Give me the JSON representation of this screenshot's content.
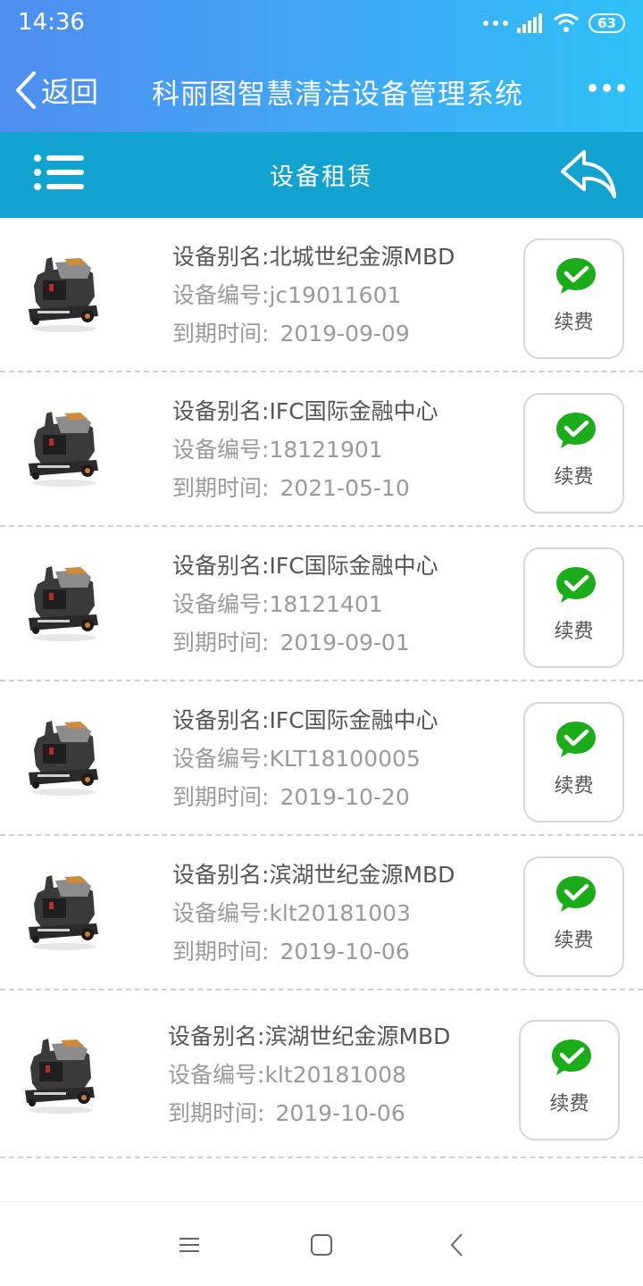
{
  "status_bar": {
    "time": "14:36",
    "battery": "63",
    "icons": [
      "more-dots-icon",
      "signal-icon",
      "wifi-icon",
      "battery-icon"
    ]
  },
  "header": {
    "back_label": "返回",
    "title": "科丽图智慧清洁设备管理系统"
  },
  "subheader": {
    "title": "设备租赁"
  },
  "labels": {
    "alias": "设备别名:",
    "number": "设备编号:",
    "expiry": "到期时间:",
    "renew": "续费"
  },
  "devices": [
    {
      "alias": "北城世纪金源MBD",
      "number": "jc19011601",
      "expiry": "2019-09-09"
    },
    {
      "alias": "IFC国际金融中心",
      "number": "18121901",
      "expiry": "2021-05-10"
    },
    {
      "alias": "IFC国际金融中心",
      "number": "18121401",
      "expiry": "2019-09-01"
    },
    {
      "alias": "IFC国际金融中心",
      "number": "KLT18100005",
      "expiry": "2019-10-20"
    },
    {
      "alias": "滨湖世纪金源MBD",
      "number": "klt20181003",
      "expiry": "2019-10-06"
    },
    {
      "alias": "滨湖世纪金源MBD",
      "number": "klt20181008",
      "expiry": "2019-10-06"
    }
  ],
  "colors": {
    "header_gradient_start": "#4f8ef0",
    "header_gradient_end": "#2fc0f7",
    "subheader": "#12a3d0",
    "wechat_green": "#1aad19"
  }
}
